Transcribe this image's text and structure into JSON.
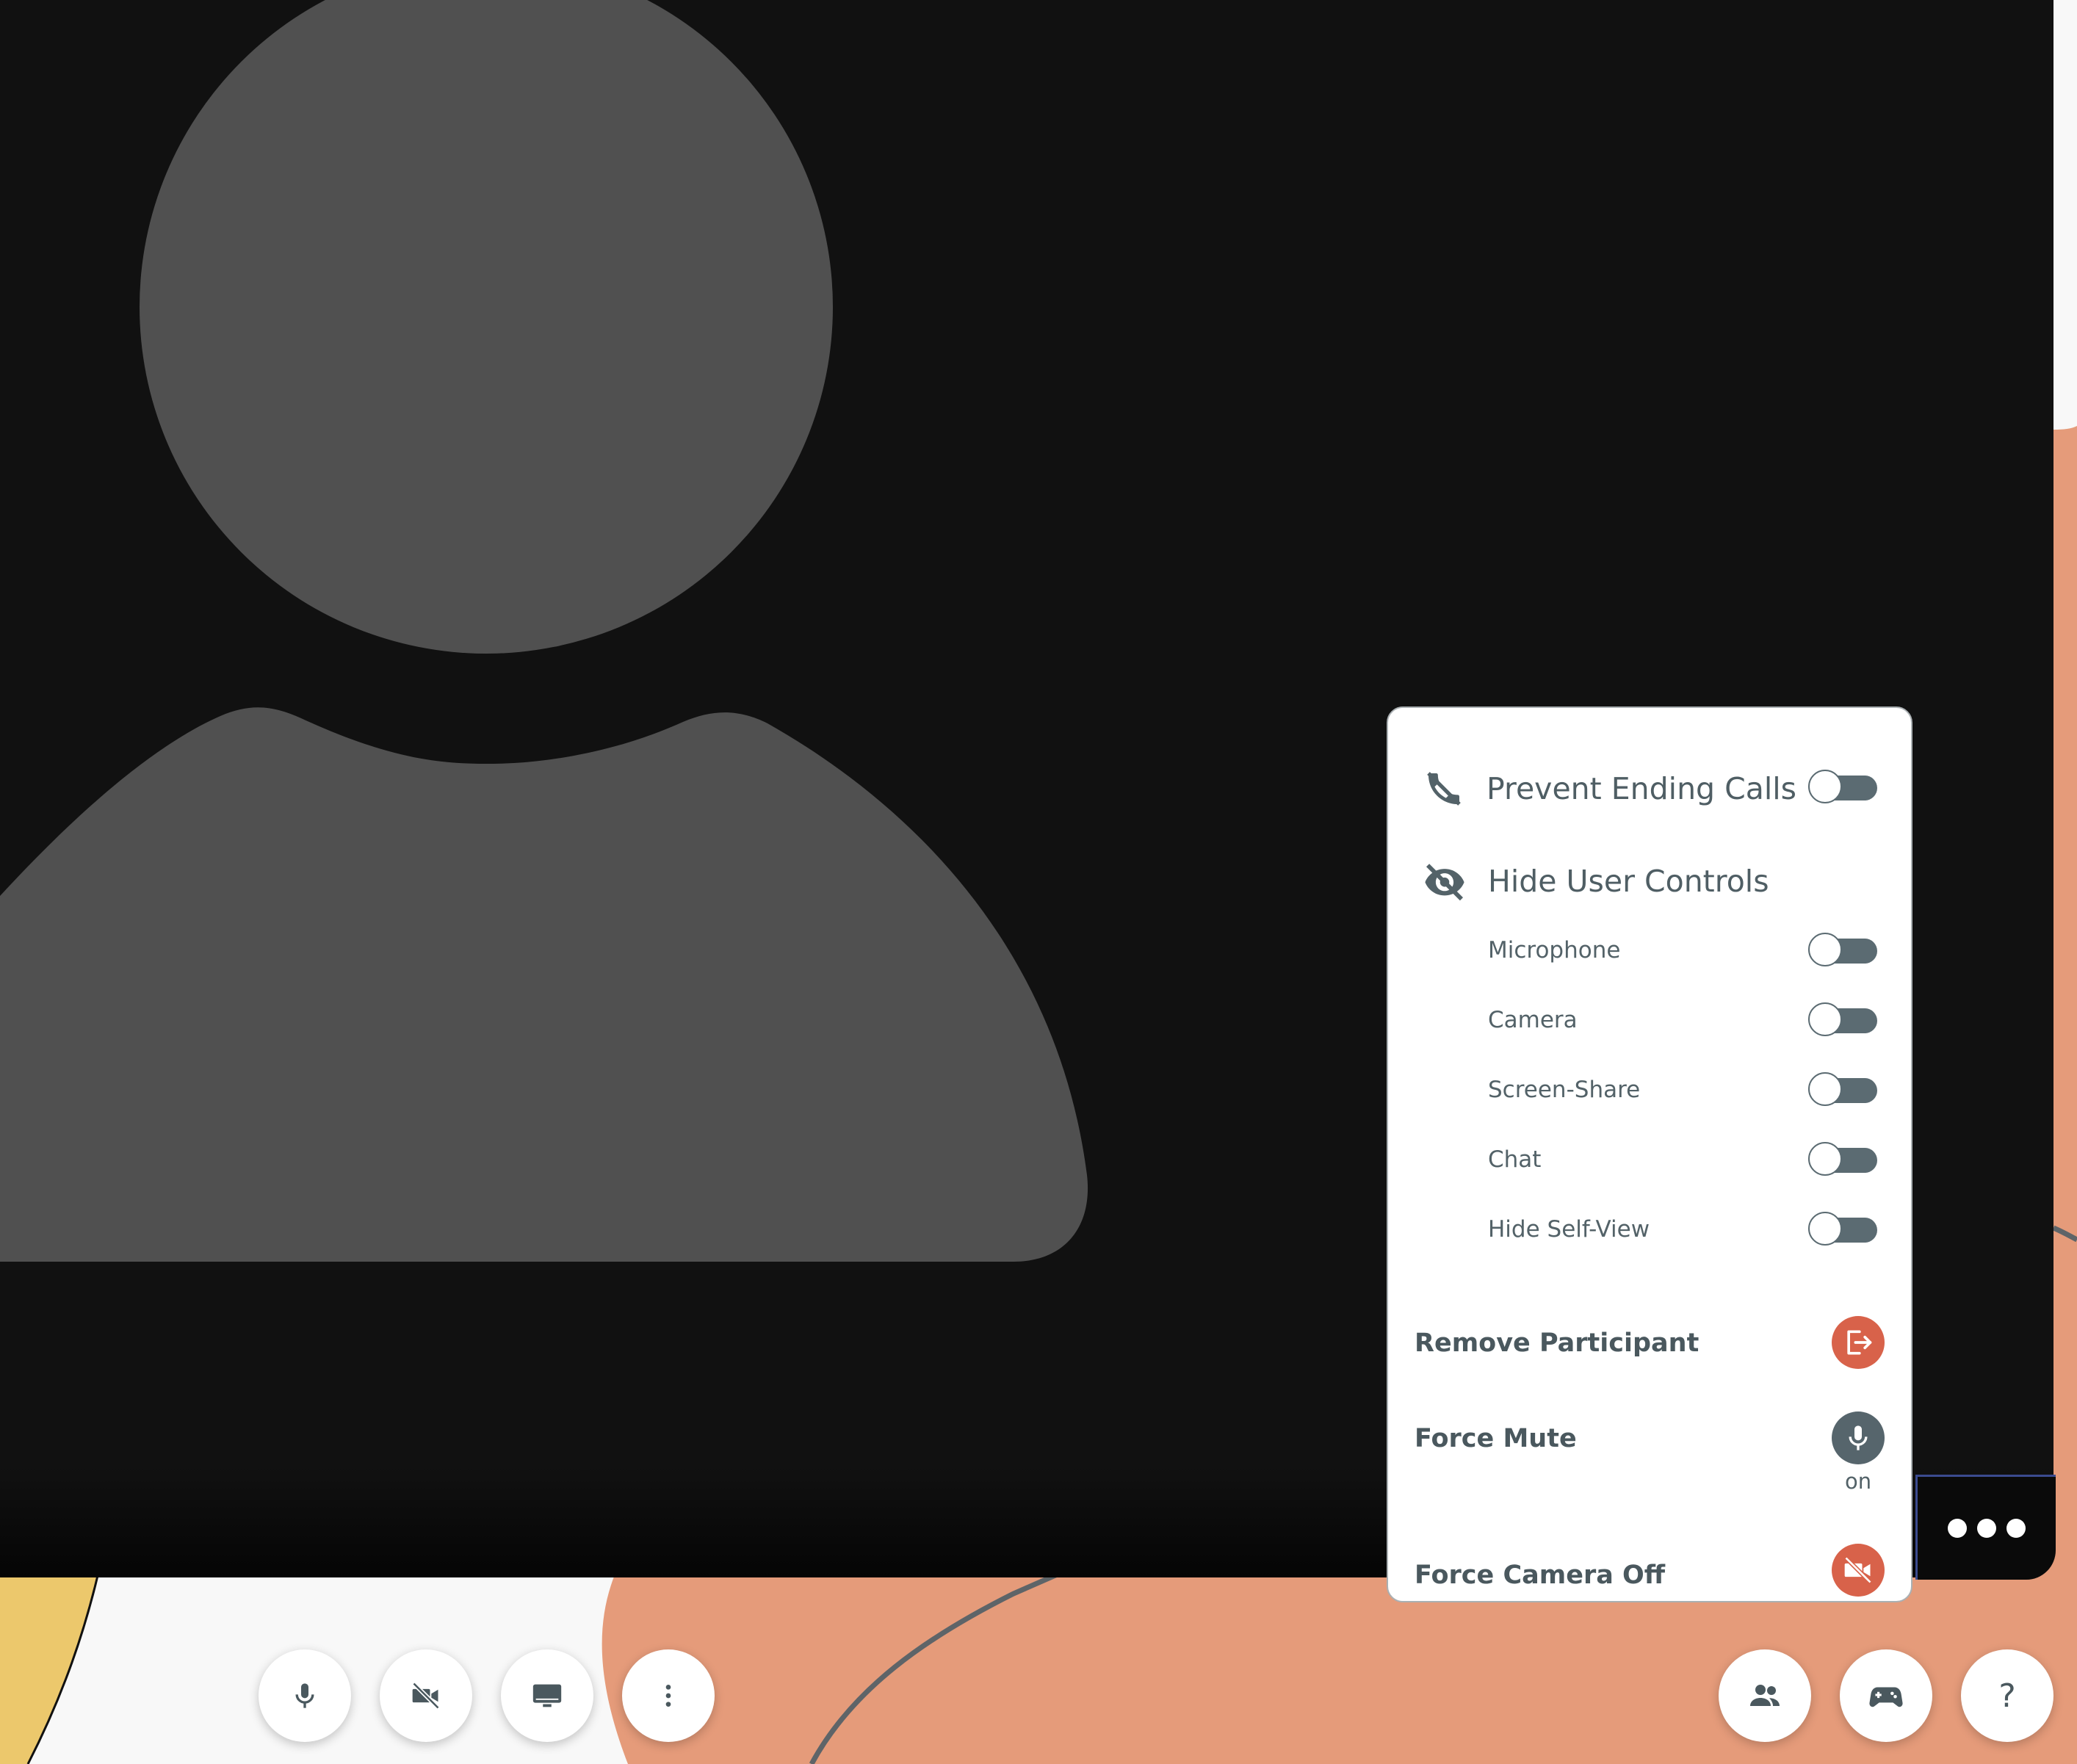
{
  "colors": {
    "video_bg": "#111111",
    "avatar": "#505050",
    "accent_red": "#d8624a",
    "toggle": "#5b6b72",
    "text": "#536268",
    "peach": "#e59b7a",
    "yellow": "#ecc86c"
  },
  "tile": {
    "more_icon": "more-horizontal-icon"
  },
  "panel": {
    "prevent_ending_calls": {
      "label": "Prevent Ending Calls",
      "icon": "call-end-off-icon",
      "enabled": false
    },
    "hide_user_controls": {
      "label": "Hide User Controls",
      "icon": "eye-off-icon",
      "items": [
        {
          "label": "Microphone",
          "enabled": false
        },
        {
          "label": "Camera",
          "enabled": false
        },
        {
          "label": "Screen-Share",
          "enabled": false
        },
        {
          "label": "Chat",
          "enabled": false
        },
        {
          "label": "Hide Self-View",
          "enabled": false
        }
      ]
    },
    "remove_participant": {
      "label": "Remove Participant",
      "icon": "exit-icon"
    },
    "force_mute": {
      "label": "Force Mute",
      "icon": "microphone-icon",
      "status": "on"
    },
    "force_camera_off": {
      "label": "Force Camera Off",
      "icon": "video-off-icon"
    }
  },
  "controls": {
    "left": [
      "microphone-icon",
      "video-off-icon",
      "screen-share-icon",
      "more-vertical-icon"
    ],
    "right": [
      "participants-icon",
      "gamepad-icon",
      "help-icon"
    ],
    "help_glyph": "?"
  }
}
